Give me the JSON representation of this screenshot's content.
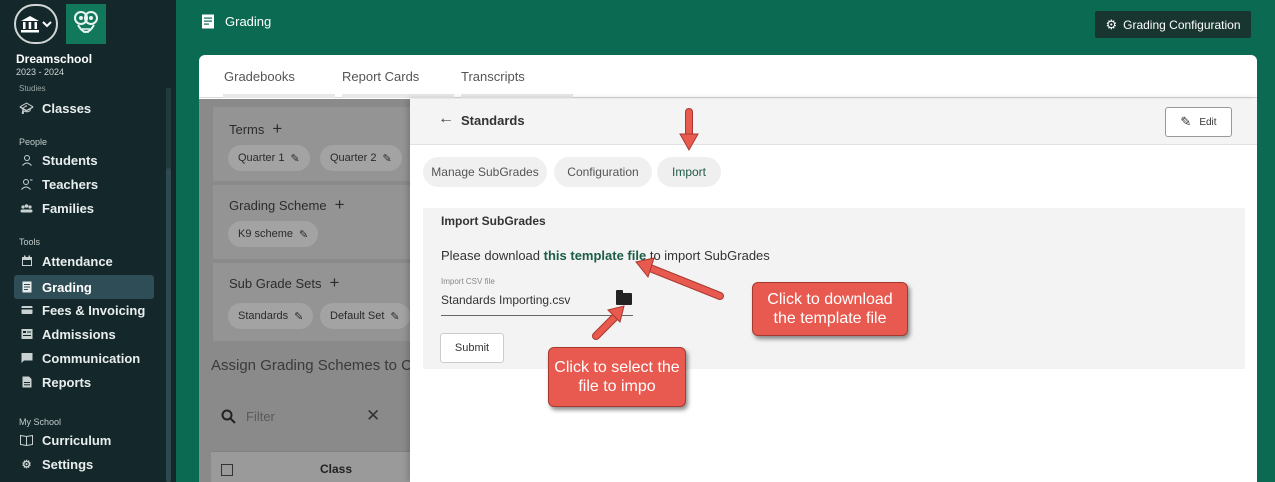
{
  "sidebar": {
    "school_name": "Dreamschool",
    "school_year": "2023 - 2024",
    "partial_label": "Studies",
    "sections": {
      "people": "People",
      "tools": "Tools",
      "my_school": "My School"
    },
    "items": {
      "classes": "Classes",
      "students": "Students",
      "teachers": "Teachers",
      "families": "Families",
      "attendance": "Attendance",
      "grading": "Grading",
      "fees": "Fees & Invoicing",
      "admissions": "Admissions",
      "communication": "Communication",
      "reports": "Reports",
      "curriculum": "Curriculum",
      "settings": "Settings"
    }
  },
  "header": {
    "title": "Grading",
    "config_button": "Grading Configuration"
  },
  "tabs": {
    "gradebooks": "Gradebooks",
    "report_cards": "Report Cards",
    "transcripts": "Transcripts"
  },
  "background": {
    "terms_title": "Terms",
    "term_chips": [
      "Quarter 1",
      "Quarter 2"
    ],
    "scheme_title": "Grading Scheme",
    "scheme_chip": "K9 scheme",
    "subgrade_title": "Sub Grade Sets",
    "subgrade_chips": [
      "Standards",
      "Default Set"
    ],
    "assign_heading": "Assign Grading Schemes to C",
    "filter_placeholder": "Filter",
    "table_header": "Class"
  },
  "overlay": {
    "title": "Standards",
    "edit_button": "Edit",
    "pills": {
      "manage": "Manage SubGrades",
      "configuration": "Configuration",
      "import": "Import"
    },
    "import_box": {
      "title": "Import SubGrades",
      "text_before": "Please download ",
      "link_text": "this template file",
      "text_after": " to import SubGrades",
      "csv_label": "Import CSV file",
      "csv_value": "Standards Importing.csv",
      "submit": "Submit"
    }
  },
  "callouts": {
    "download": "Click to download the template file",
    "select": "Click to select the file to impo"
  },
  "colors": {
    "header_green": "#0b6b52",
    "sidebar_dark": "#14282c",
    "link_green": "#1d5c46",
    "callout_red": "#e85a4f"
  }
}
